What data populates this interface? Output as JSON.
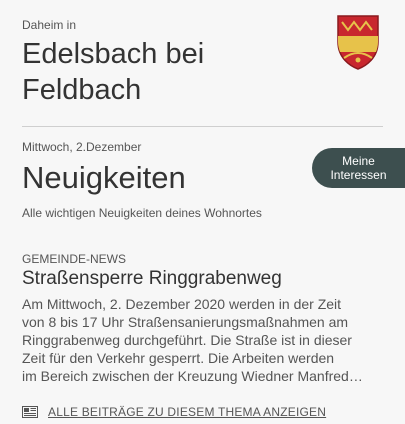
{
  "header": {
    "pre_label": "Daheim in",
    "town_line1": "Edelsbach bei",
    "town_line2": "Feldbach"
  },
  "crest_icon": "coat-of-arms-icon",
  "news": {
    "date": "Mittwoch, 2.Dezember",
    "title": "Neuigkeiten",
    "subtitle": "Alle wichtigen Neuigkeiten deines Wohnortes",
    "interests_line1": "Meine",
    "interests_line2": "Interessen"
  },
  "article": {
    "category": "GEMEINDE-NEWS",
    "title": "Straßensperre Ringgrabenweg",
    "lines": [
      "Am Mittwoch, 2. Dezember 2020 werden in der Zeit",
      "von 8 bis 17 Uhr Straßensanierungsmaßnahmen am",
      "Ringgrabenweg durchgeführt. Die Straße ist in dieser",
      "Zeit für den Verkehr gesperrt. Die Arbeiten werden",
      "im Bereich zwischen der Kreuzung Wiedner Manfred…"
    ]
  },
  "all_posts_link": {
    "label": "ALLE BEITRÄGE ZU DIESEM THEMA ANZEIGEN",
    "icon": "newspaper-icon"
  },
  "colors": {
    "background": "#f7f7f7",
    "text": "#333333",
    "muted_text": "#555555",
    "button_bg": "#3d4f4f",
    "crest_red": "#c8272e",
    "crest_gold": "#e7c24a"
  }
}
